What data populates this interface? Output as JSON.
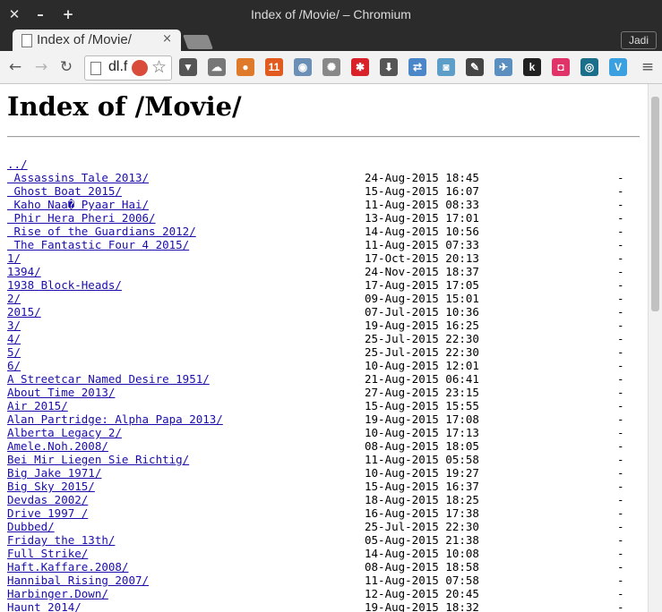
{
  "window": {
    "title": "Index of /Movie/ – Chromium",
    "close": "✕",
    "minimize": "–",
    "maximize": "+"
  },
  "tab": {
    "label": "Index of /Movie/",
    "close": "×"
  },
  "profile": "Jadi",
  "toolbar": {
    "back": "←",
    "forward": "→",
    "reload": "↻",
    "url": "dl.f",
    "star": "☆",
    "menu": "≡"
  },
  "extensions": [
    {
      "name": "pocket-icon",
      "glyph": "▼",
      "color": "#555555"
    },
    {
      "name": "cloud-icon",
      "glyph": "☁",
      "color": "#777777"
    },
    {
      "name": "fox-icon",
      "glyph": "●",
      "color": "#e07a2b"
    },
    {
      "name": "rss-counter-icon",
      "glyph": "11",
      "color": "#e15a1f"
    },
    {
      "name": "owl-icon",
      "glyph": "◉",
      "color": "#6b8fb5"
    },
    {
      "name": "film-reel-icon",
      "glyph": "✺",
      "color": "#888888"
    },
    {
      "name": "asterisk-icon",
      "glyph": "✱",
      "color": "#d9212a"
    },
    {
      "name": "download-icon",
      "glyph": "⬇",
      "color": "#555555"
    },
    {
      "name": "translate-icon",
      "glyph": "⇄",
      "color": "#4a86c8"
    },
    {
      "name": "camera-icon",
      "glyph": "◙",
      "color": "#5d9ec9"
    },
    {
      "name": "eyedropper-icon",
      "glyph": "✎",
      "color": "#444444"
    },
    {
      "name": "satellite-icon",
      "glyph": "✈",
      "color": "#5a8fc0"
    },
    {
      "name": "k-icon",
      "glyph": "k",
      "color": "#222222"
    },
    {
      "name": "chat-icon",
      "glyph": "◘",
      "color": "#e0336a"
    },
    {
      "name": "wave-icon",
      "glyph": "◎",
      "color": "#1b6f8a"
    },
    {
      "name": "v-icon",
      "glyph": "V",
      "color": "#3aa0e0"
    }
  ],
  "page": {
    "title": "Index of /Movie/",
    "entries": [
      {
        "name": "../",
        "date": "",
        "size": ""
      },
      {
        "name": " Assassins Tale 2013/",
        "date": "24-Aug-2015 18:45",
        "size": "-"
      },
      {
        "name": " Ghost Boat 2015/",
        "date": "15-Aug-2015 16:07",
        "size": "-"
      },
      {
        "name": " Kaho Naa� Pyaar Hai/",
        "date": "11-Aug-2015 08:33",
        "size": "-"
      },
      {
        "name": " Phir Hera Pheri 2006/",
        "date": "13-Aug-2015 17:01",
        "size": "-"
      },
      {
        "name": " Rise of the Guardians 2012/",
        "date": "14-Aug-2015 10:56",
        "size": "-"
      },
      {
        "name": " The Fantastic Four 4 2015/",
        "date": "11-Aug-2015 07:33",
        "size": "-"
      },
      {
        "name": "1/",
        "date": "17-Oct-2015 20:13",
        "size": "-"
      },
      {
        "name": "1394/",
        "date": "24-Nov-2015 18:37",
        "size": "-"
      },
      {
        "name": "1938 Block-Heads/",
        "date": "17-Aug-2015 17:05",
        "size": "-"
      },
      {
        "name": "2/",
        "date": "09-Aug-2015 15:01",
        "size": "-"
      },
      {
        "name": "2015/",
        "date": "07-Jul-2015 10:36",
        "size": "-"
      },
      {
        "name": "3/",
        "date": "19-Aug-2015 16:25",
        "size": "-"
      },
      {
        "name": "4/",
        "date": "25-Jul-2015 22:30",
        "size": "-"
      },
      {
        "name": "5/",
        "date": "25-Jul-2015 22:30",
        "size": "-"
      },
      {
        "name": "6/",
        "date": "10-Aug-2015 12:01",
        "size": "-"
      },
      {
        "name": "A Streetcar Named Desire 1951/",
        "date": "21-Aug-2015 06:41",
        "size": "-"
      },
      {
        "name": "About Time 2013/",
        "date": "27-Aug-2015 23:15",
        "size": "-"
      },
      {
        "name": "Air 2015/",
        "date": "15-Aug-2015 15:55",
        "size": "-"
      },
      {
        "name": "Alan Partridge: Alpha Papa 2013/",
        "date": "19-Aug-2015 17:08",
        "size": "-"
      },
      {
        "name": "Alberta Legacy 2/",
        "date": "10-Aug-2015 17:13",
        "size": "-"
      },
      {
        "name": "Amele.Noh.2008/",
        "date": "08-Aug-2015 18:05",
        "size": "-"
      },
      {
        "name": "Bei Mir Liegen Sie Richtig/",
        "date": "11-Aug-2015 05:58",
        "size": "-"
      },
      {
        "name": "Big Jake 1971/",
        "date": "10-Aug-2015 19:27",
        "size": "-"
      },
      {
        "name": "Big Sky 2015/",
        "date": "15-Aug-2015 16:37",
        "size": "-"
      },
      {
        "name": "Devdas 2002/",
        "date": "18-Aug-2015 18:25",
        "size": "-"
      },
      {
        "name": "Drive 1997 /",
        "date": "16-Aug-2015 17:38",
        "size": "-"
      },
      {
        "name": "Dubbed/",
        "date": "25-Jul-2015 22:30",
        "size": "-"
      },
      {
        "name": "Friday the 13th/",
        "date": "05-Aug-2015 21:38",
        "size": "-"
      },
      {
        "name": "Full Strike/",
        "date": "14-Aug-2015 10:08",
        "size": "-"
      },
      {
        "name": "Haft.Kaffare.2008/",
        "date": "08-Aug-2015 18:58",
        "size": "-"
      },
      {
        "name": "Hannibal Rising 2007/",
        "date": "11-Aug-2015 07:58",
        "size": "-"
      },
      {
        "name": "Harbinger.Down/",
        "date": "12-Aug-2015 20:45",
        "size": "-"
      },
      {
        "name": "Haunt 2014/",
        "date": "19-Aug-2015 18:32",
        "size": "-"
      }
    ]
  }
}
